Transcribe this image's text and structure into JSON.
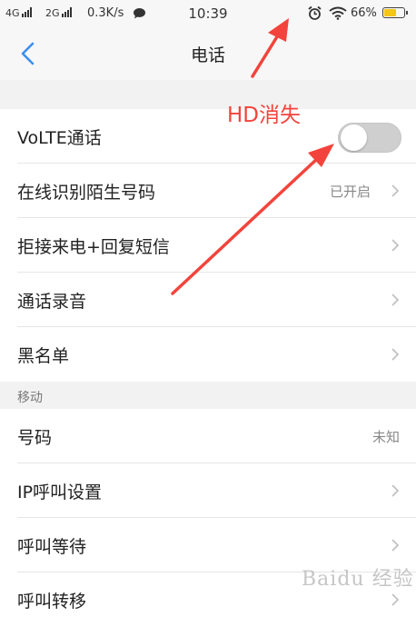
{
  "status_bar": {
    "network_1": "4G",
    "network_2": "2G",
    "speed": "0.3K/s",
    "time": "10:39",
    "battery_text": "66%",
    "battery_level": 0.66,
    "icons": [
      "signal-icon",
      "chat-bubble-icon",
      "alarm-clock-icon",
      "wifi-icon",
      "battery-icon"
    ]
  },
  "header": {
    "title": "电话",
    "back_icon": "back-chevron-icon"
  },
  "settings": {
    "items": [
      {
        "label": "VoLTE通话",
        "control": "toggle",
        "toggle_on": false
      },
      {
        "label": "在线识别陌生号码",
        "value": "已开启"
      },
      {
        "label": "拒接来电+回复短信"
      },
      {
        "label": "通话录音"
      },
      {
        "label": "黑名单"
      }
    ]
  },
  "mobile_section": {
    "header": "移动",
    "items": [
      {
        "label": "号码",
        "value": "未知"
      },
      {
        "label": "IP呼叫设置"
      },
      {
        "label": "呼叫等待"
      },
      {
        "label": "呼叫转移"
      }
    ]
  },
  "annotation": {
    "text": "HD消失",
    "color": "#f2443c"
  },
  "colors": {
    "accent": "#3b8ef0",
    "annotation": "#f2443c",
    "toggle_off": "#cfcfcf",
    "battery": "#f5c518"
  },
  "watermark": "Baidu 经验"
}
